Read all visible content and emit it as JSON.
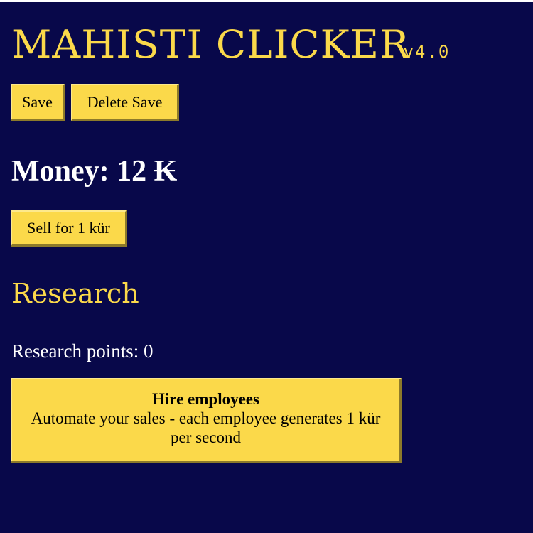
{
  "header": {
    "title": "MAHISTI CLICKER",
    "version": "v4.0"
  },
  "toolbar": {
    "save_label": "Save",
    "delete_save_label": "Delete Save"
  },
  "money": {
    "text": "Money: 12 ₭"
  },
  "sell": {
    "label": "Sell for 1 kür"
  },
  "research": {
    "heading": "Research",
    "points_text": "Research points: 0",
    "upgrades": [
      {
        "name": "Hire employees",
        "description": "Automate your sales - each employee generates 1 kür per second"
      }
    ]
  },
  "colors": {
    "background": "#08084a",
    "accent": "#fbd94a",
    "text": "#ffffff"
  }
}
